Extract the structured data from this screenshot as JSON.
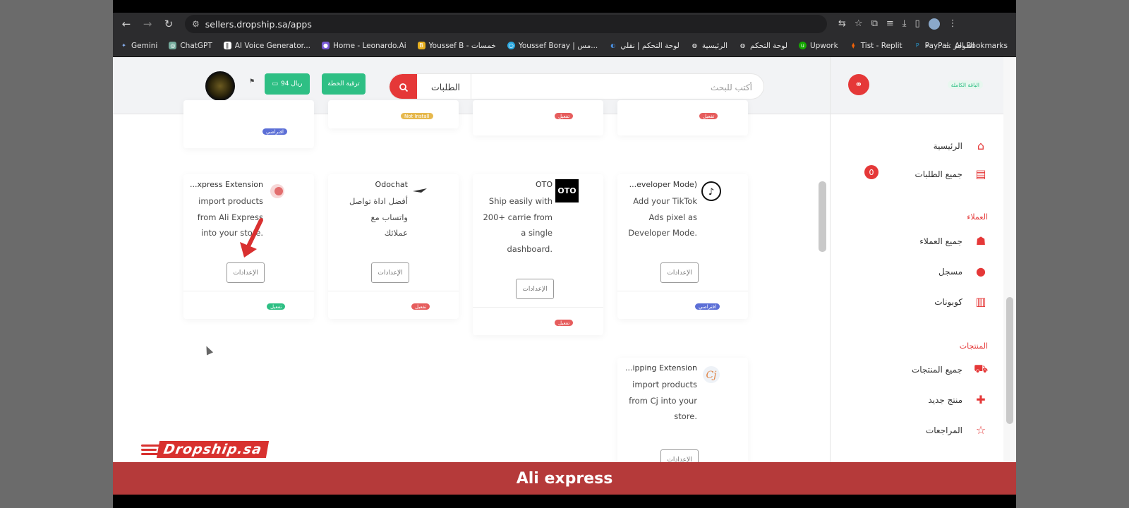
{
  "browser": {
    "url": "sellers.dropship.sa/apps",
    "bookmarks": [
      "Gemini",
      "ChatGPT",
      "AI Voice Generator...",
      "Home - Leonardo.Ai",
      "Youssef B - خمسات",
      "Youssef Boray | مس...",
      "لوحة التحكم | نقلي",
      "الرئيسية",
      "لوحة التحكم",
      "Upwork",
      "Tist - Replit",
      "PayPal: الموجز"
    ],
    "all_bookmarks": "All Bookmarks"
  },
  "header": {
    "search_placeholder": "أكتب للبحث",
    "search_scope": "الطلبات",
    "upgrade_label": "ترقية الخطة",
    "wallet_label": "94 ريال"
  },
  "sidebar": {
    "plan": "الباقة الكاملة",
    "home": "الرئيسية",
    "all_orders": "جميع الطلبات",
    "orders_count": "0",
    "section_customers": "العملاء",
    "all_customers": "جميع العملاء",
    "registered": "مسجل",
    "coupons": "كوبونات",
    "section_products": "المنتجات",
    "all_products": "جميع المنتجات",
    "new_product": "منتج جديد",
    "reviews": "المراجعات"
  },
  "cards_top_badges": {
    "b1": "افتراضي",
    "b2": "Not Install",
    "b3": "تفعيل",
    "b4": "تفعيل"
  },
  "cards": [
    {
      "title": "...xpress Extension",
      "desc": [
        "import products",
        "from Ali Express",
        "into your store."
      ],
      "button": "الإعدادات",
      "badge": "تفعيل"
    },
    {
      "title": "Odochat",
      "desc": [
        "أفضل اداة تواصل",
        "واتساب مع",
        "عملائك"
      ],
      "button": "الإعدادات",
      "badge": "تفعيل"
    },
    {
      "title": "OTO",
      "logo_text": "OTO",
      "desc": [
        "Ship easily with",
        "200+ carrie from",
        "a single",
        "dashboard."
      ],
      "button": "الإعدادات",
      "badge": "تفعيل"
    },
    {
      "title": "...eveloper Mode)",
      "desc": [
        "Add your TikTok",
        "Ads pixel as",
        "Developer Mode."
      ],
      "button": "الإعدادات",
      "badge": "افتراضي"
    },
    {
      "title": "...ipping Extension",
      "desc": [
        "import products",
        "from Cj into your",
        "store."
      ],
      "button": "الإعدادات"
    }
  ],
  "banner": "Ali express",
  "brand": "Dropship.sa",
  "colors": {
    "accent": "#e53838",
    "green": "#2ebf84",
    "banner": "#b53a3a"
  }
}
